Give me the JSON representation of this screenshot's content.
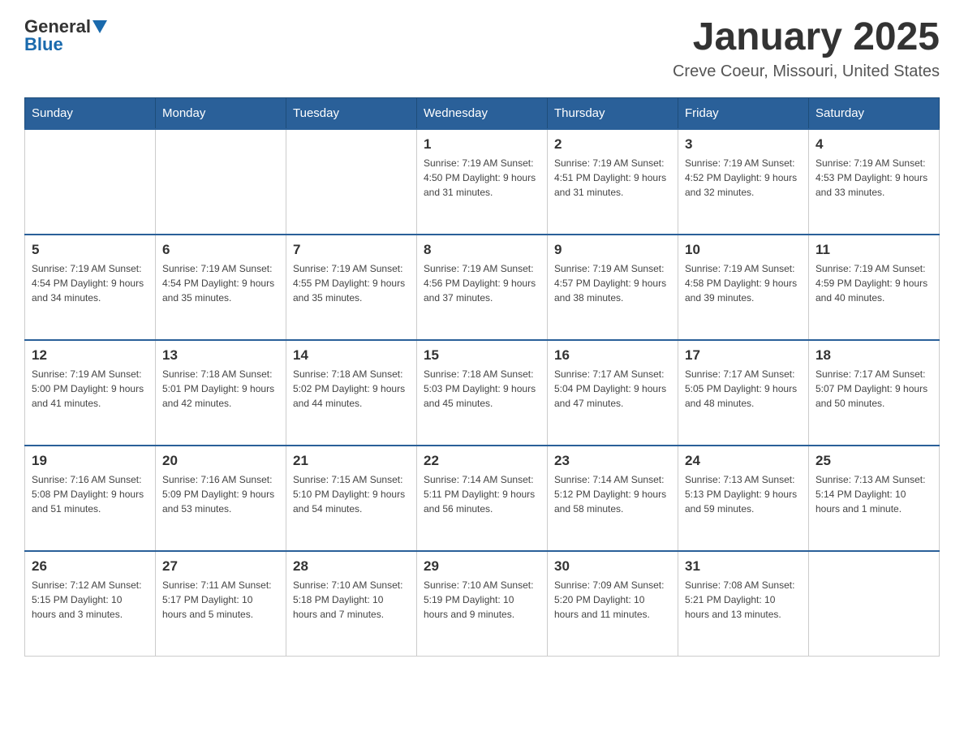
{
  "header": {
    "logo": {
      "general": "General",
      "arrow": "▼",
      "blue": "Blue"
    },
    "title": "January 2025",
    "subtitle": "Creve Coeur, Missouri, United States"
  },
  "calendar": {
    "days_of_week": [
      "Sunday",
      "Monday",
      "Tuesday",
      "Wednesday",
      "Thursday",
      "Friday",
      "Saturday"
    ],
    "weeks": [
      [
        {
          "day": "",
          "info": ""
        },
        {
          "day": "",
          "info": ""
        },
        {
          "day": "",
          "info": ""
        },
        {
          "day": "1",
          "info": "Sunrise: 7:19 AM\nSunset: 4:50 PM\nDaylight: 9 hours and 31 minutes."
        },
        {
          "day": "2",
          "info": "Sunrise: 7:19 AM\nSunset: 4:51 PM\nDaylight: 9 hours and 31 minutes."
        },
        {
          "day": "3",
          "info": "Sunrise: 7:19 AM\nSunset: 4:52 PM\nDaylight: 9 hours and 32 minutes."
        },
        {
          "day": "4",
          "info": "Sunrise: 7:19 AM\nSunset: 4:53 PM\nDaylight: 9 hours and 33 minutes."
        }
      ],
      [
        {
          "day": "5",
          "info": "Sunrise: 7:19 AM\nSunset: 4:54 PM\nDaylight: 9 hours and 34 minutes."
        },
        {
          "day": "6",
          "info": "Sunrise: 7:19 AM\nSunset: 4:54 PM\nDaylight: 9 hours and 35 minutes."
        },
        {
          "day": "7",
          "info": "Sunrise: 7:19 AM\nSunset: 4:55 PM\nDaylight: 9 hours and 35 minutes."
        },
        {
          "day": "8",
          "info": "Sunrise: 7:19 AM\nSunset: 4:56 PM\nDaylight: 9 hours and 37 minutes."
        },
        {
          "day": "9",
          "info": "Sunrise: 7:19 AM\nSunset: 4:57 PM\nDaylight: 9 hours and 38 minutes."
        },
        {
          "day": "10",
          "info": "Sunrise: 7:19 AM\nSunset: 4:58 PM\nDaylight: 9 hours and 39 minutes."
        },
        {
          "day": "11",
          "info": "Sunrise: 7:19 AM\nSunset: 4:59 PM\nDaylight: 9 hours and 40 minutes."
        }
      ],
      [
        {
          "day": "12",
          "info": "Sunrise: 7:19 AM\nSunset: 5:00 PM\nDaylight: 9 hours and 41 minutes."
        },
        {
          "day": "13",
          "info": "Sunrise: 7:18 AM\nSunset: 5:01 PM\nDaylight: 9 hours and 42 minutes."
        },
        {
          "day": "14",
          "info": "Sunrise: 7:18 AM\nSunset: 5:02 PM\nDaylight: 9 hours and 44 minutes."
        },
        {
          "day": "15",
          "info": "Sunrise: 7:18 AM\nSunset: 5:03 PM\nDaylight: 9 hours and 45 minutes."
        },
        {
          "day": "16",
          "info": "Sunrise: 7:17 AM\nSunset: 5:04 PM\nDaylight: 9 hours and 47 minutes."
        },
        {
          "day": "17",
          "info": "Sunrise: 7:17 AM\nSunset: 5:05 PM\nDaylight: 9 hours and 48 minutes."
        },
        {
          "day": "18",
          "info": "Sunrise: 7:17 AM\nSunset: 5:07 PM\nDaylight: 9 hours and 50 minutes."
        }
      ],
      [
        {
          "day": "19",
          "info": "Sunrise: 7:16 AM\nSunset: 5:08 PM\nDaylight: 9 hours and 51 minutes."
        },
        {
          "day": "20",
          "info": "Sunrise: 7:16 AM\nSunset: 5:09 PM\nDaylight: 9 hours and 53 minutes."
        },
        {
          "day": "21",
          "info": "Sunrise: 7:15 AM\nSunset: 5:10 PM\nDaylight: 9 hours and 54 minutes."
        },
        {
          "day": "22",
          "info": "Sunrise: 7:14 AM\nSunset: 5:11 PM\nDaylight: 9 hours and 56 minutes."
        },
        {
          "day": "23",
          "info": "Sunrise: 7:14 AM\nSunset: 5:12 PM\nDaylight: 9 hours and 58 minutes."
        },
        {
          "day": "24",
          "info": "Sunrise: 7:13 AM\nSunset: 5:13 PM\nDaylight: 9 hours and 59 minutes."
        },
        {
          "day": "25",
          "info": "Sunrise: 7:13 AM\nSunset: 5:14 PM\nDaylight: 10 hours and 1 minute."
        }
      ],
      [
        {
          "day": "26",
          "info": "Sunrise: 7:12 AM\nSunset: 5:15 PM\nDaylight: 10 hours and 3 minutes."
        },
        {
          "day": "27",
          "info": "Sunrise: 7:11 AM\nSunset: 5:17 PM\nDaylight: 10 hours and 5 minutes."
        },
        {
          "day": "28",
          "info": "Sunrise: 7:10 AM\nSunset: 5:18 PM\nDaylight: 10 hours and 7 minutes."
        },
        {
          "day": "29",
          "info": "Sunrise: 7:10 AM\nSunset: 5:19 PM\nDaylight: 10 hours and 9 minutes."
        },
        {
          "day": "30",
          "info": "Sunrise: 7:09 AM\nSunset: 5:20 PM\nDaylight: 10 hours and 11 minutes."
        },
        {
          "day": "31",
          "info": "Sunrise: 7:08 AM\nSunset: 5:21 PM\nDaylight: 10 hours and 13 minutes."
        },
        {
          "day": "",
          "info": ""
        }
      ]
    ]
  }
}
